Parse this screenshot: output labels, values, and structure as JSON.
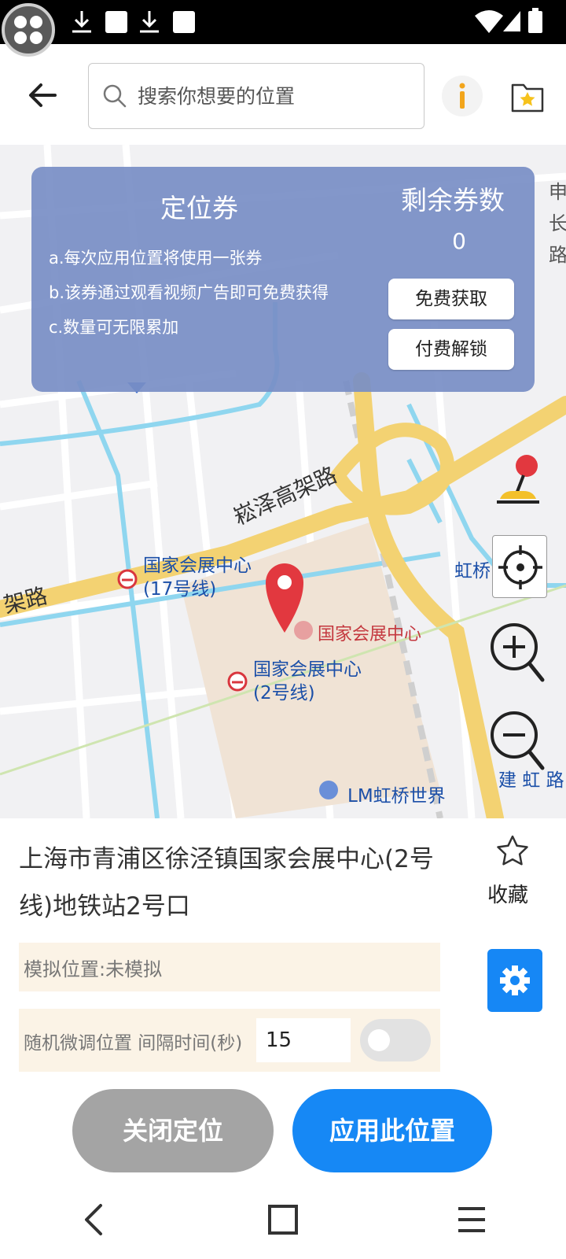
{
  "search": {
    "placeholder": "搜索你想要的位置"
  },
  "icons": {
    "back": "back-arrow-icon",
    "search": "search-icon",
    "info": "info-icon",
    "favorites_folder": "star-folder-icon",
    "joystick": "joystick-icon",
    "locate": "crosshair-locate-icon",
    "zoom_in": "zoom-in-icon",
    "zoom_out": "zoom-out-icon",
    "favorite": "star-outline-icon",
    "settings": "gear-icon"
  },
  "coupon": {
    "title": "定位券",
    "rules": [
      "a.每次应用位置将使用一张券",
      "b.该券通过观看视频广告即可免费获得",
      "c.数量可无限累加"
    ],
    "remaining_label": "剩余券数",
    "remaining_count": "0",
    "free_get_label": "免费获取",
    "paid_unlock_label": "付费解锁"
  },
  "map": {
    "labels": {
      "expressway": "崧泽高架路",
      "road_left": "架路",
      "station_17": "国家会展中心\n(17号线)",
      "venue": "国家会展中心",
      "station_2": "国家会展中心\n(2号线)",
      "hongqiao": "虹桥",
      "lm_hongqiao": "LM虹桥世界",
      "jianhong_road": "建 虹 路",
      "right_top": "申\n长\n路"
    }
  },
  "location": {
    "address": "上海市青浦区徐泾镇国家会展中心(2号线)地铁站2号口",
    "favorite_label": "收藏",
    "simulation_status": "模拟位置:未模拟",
    "jitter_label": "随机微调位置 间隔时间(秒)",
    "interval_value": "15",
    "jitter_enabled": false,
    "close_label": "关闭定位",
    "apply_label": "应用此位置"
  },
  "colors": {
    "primary": "#1688f5",
    "disabled": "#a4a4a4",
    "panel": "#7c92c8",
    "road_major": "#f3d272",
    "water": "#8fd6ef",
    "pin": "#e2383f"
  }
}
